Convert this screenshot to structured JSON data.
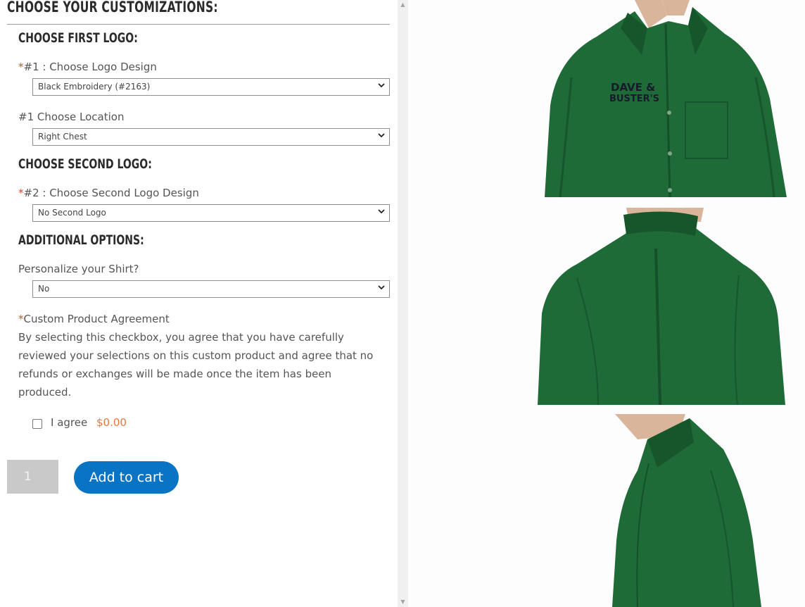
{
  "customization": {
    "heading": "CHOOSE YOUR CUSTOMIZATIONS:",
    "first_logo_heading": "CHOOSE FIRST LOGO:",
    "logo_design_required": "*",
    "logo_design_label": "#1 : Choose Logo Design",
    "logo_design_value": "Black Embroidery (#2163)",
    "location_label": "#1 Choose Location",
    "location_value": "Right Chest",
    "second_logo_heading": "CHOOSE SECOND LOGO:",
    "second_design_required": "*",
    "second_design_label": "#2 : Choose Second Logo Design",
    "second_design_value": "No Second Logo",
    "additional_heading": "ADDITIONAL OPTIONS:",
    "personalize_label": "Personalize your Shirt?",
    "personalize_value": "No",
    "agreement_required": "*",
    "agreement_label": "Custom Product Agreement",
    "agreement_text": "By selecting this checkbox, you agree that you have carefully reviewed your selections on this custom product and agree that no refunds or exchanges will be made once the item has been produced.",
    "agree_label": "I agree",
    "agree_price": "$0.00"
  },
  "cart": {
    "quantity": "1",
    "add_label": "Add to cart"
  },
  "gallery": {
    "logo_line1": "DAVE &",
    "logo_line2": "BUSTER'S",
    "shirt_color": "#1e6b37"
  },
  "colors": {
    "accent": "#0a74c4",
    "price": "#f0743e",
    "required": "#e8432d"
  }
}
